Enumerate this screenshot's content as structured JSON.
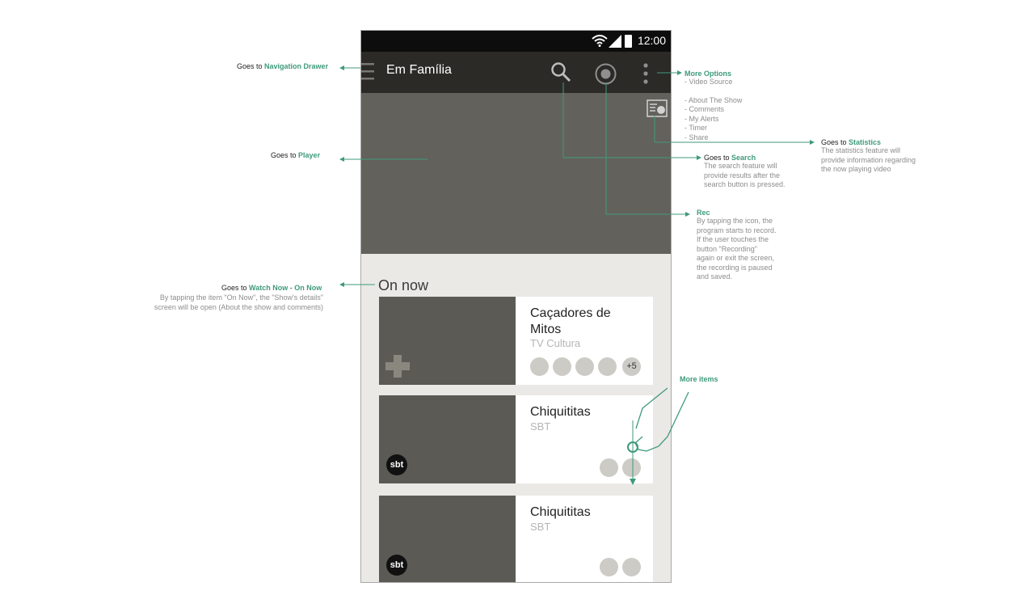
{
  "status_bar": {
    "time": "12:00"
  },
  "app_bar": {
    "title": "Em Família"
  },
  "section": {
    "title": "On now"
  },
  "cards": [
    {
      "title": "Caçadores de Mitos",
      "channel": "TV Cultura",
      "more_count": "+5"
    },
    {
      "title": "Chiquititas",
      "channel": "SBT",
      "logo": "sbt"
    },
    {
      "title": "Chiquititas",
      "channel": "SBT",
      "logo": "sbt"
    }
  ],
  "annotations": {
    "nav_drawer": {
      "prefix": "Goes to",
      "target": "Navigation Drawer"
    },
    "player": {
      "prefix": "Goes to",
      "target": "Player"
    },
    "watch_now": {
      "prefix": "Goes to",
      "target": "Watch Now - On Now",
      "desc1": "By tapping the item \"On Now\", the \"Show's details\"",
      "desc2": "screen will be open (About the show and comments)"
    },
    "more_options": {
      "title": "More Options",
      "items": [
        "- Video Source",
        "- About The Show",
        "- Comments",
        "- My Alerts",
        "- Timer",
        "- Share"
      ]
    },
    "statistics": {
      "prefix": "Goes to",
      "target": "Statistics",
      "desc": [
        "The statistics feature will",
        "provide information regarding",
        "the now playing video"
      ]
    },
    "search": {
      "prefix": "Goes to",
      "target": "Search",
      "desc": [
        "The search feature will",
        "provide results after the",
        "search button is pressed."
      ]
    },
    "rec": {
      "title": "Rec",
      "desc": [
        "By tapping the icon, the",
        "program starts to record.",
        "If the user touches the",
        "button \"Recording\"",
        "again or exit the screen,",
        "the recording is paused",
        "and saved."
      ]
    },
    "more_items": {
      "title": "More items"
    }
  },
  "colors": {
    "accent": "#3f9a7c",
    "appbar": "#2b2a27",
    "player": "#63615c",
    "thumb": "#5c5a55"
  }
}
